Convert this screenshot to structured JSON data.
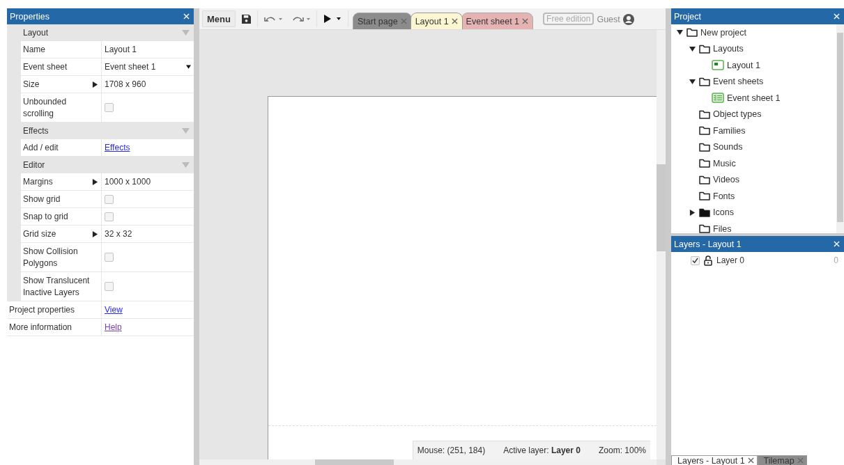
{
  "properties": {
    "title": "Properties",
    "sections": [
      {
        "title": "Layout",
        "expanded": true,
        "rows": [
          {
            "label": "Name",
            "kind": "text",
            "value": "Layout 1"
          },
          {
            "label": "Event sheet",
            "kind": "dropdown",
            "value": "Event sheet 1"
          },
          {
            "label": "Size",
            "kind": "expander",
            "value": "1708 x 960"
          },
          {
            "label": "Unbounded scrolling",
            "kind": "checkbox",
            "checked": false
          }
        ]
      },
      {
        "title": "Effects",
        "expanded": true,
        "rows": [
          {
            "label": "Add / edit",
            "kind": "link",
            "value": "Effects",
            "visited": false
          }
        ]
      },
      {
        "title": "Editor",
        "expanded": true,
        "rows": [
          {
            "label": "Margins",
            "kind": "expander",
            "value": "1000 x 1000"
          },
          {
            "label": "Show grid",
            "kind": "checkbox",
            "checked": false
          },
          {
            "label": "Snap to grid",
            "kind": "checkbox",
            "checked": false
          },
          {
            "label": "Grid size",
            "kind": "expander",
            "value": "32 x 32"
          },
          {
            "label": "Show Collision Polygons",
            "kind": "checkbox",
            "checked": false
          },
          {
            "label": "Show Translucent Inactive Layers",
            "kind": "checkbox",
            "checked": false
          }
        ]
      }
    ],
    "footer_rows": [
      {
        "label": "Project properties",
        "kind": "link",
        "value": "View",
        "visited": false
      },
      {
        "label": "More information",
        "kind": "link",
        "value": "Help",
        "visited": true
      }
    ]
  },
  "toolbar": {
    "menu": "Menu",
    "tabs": [
      {
        "label": "Start page",
        "selected": false,
        "color": "#8c8c8c"
      },
      {
        "label": "Layout 1",
        "selected": true,
        "color": "#fdf6d3"
      },
      {
        "label": "Event sheet 1",
        "selected": false,
        "color": "#e6b3b3"
      }
    ],
    "edition": "Free edition",
    "user": "Guest"
  },
  "status_bar": {
    "mouse": "Mouse: (251, 184)",
    "active_layer": "Active layer: **Layer 0**",
    "zoom": "Zoom: 100%"
  },
  "project": {
    "title": "Project",
    "tree": [
      {
        "label": "New project",
        "kind": "folder",
        "expanded": true,
        "children": [
          {
            "label": "Layouts",
            "kind": "folder",
            "expanded": true,
            "children": [
              {
                "label": "Layout 1",
                "kind": "layout"
              }
            ]
          },
          {
            "label": "Event sheets",
            "kind": "folder",
            "expanded": true,
            "children": [
              {
                "label": "Event sheet 1",
                "kind": "eventsheet"
              }
            ]
          },
          {
            "label": "Object types",
            "kind": "folder"
          },
          {
            "label": "Families",
            "kind": "folder"
          },
          {
            "label": "Sounds",
            "kind": "folder"
          },
          {
            "label": "Music",
            "kind": "folder"
          },
          {
            "label": "Videos",
            "kind": "folder"
          },
          {
            "label": "Fonts",
            "kind": "folder"
          },
          {
            "label": "Icons",
            "kind": "filled-folder",
            "expanded": false
          },
          {
            "label": "Files",
            "kind": "folder"
          }
        ]
      }
    ]
  },
  "layers": {
    "title": "Layers - Layout 1",
    "rows": [
      {
        "name": "Layer 0",
        "visible": true,
        "locked": false,
        "count": "0"
      }
    ]
  },
  "bottom_tabs": [
    {
      "label": "Layers - Layout 1",
      "selected": true
    },
    {
      "label": "Tilemap",
      "selected": false
    }
  ]
}
